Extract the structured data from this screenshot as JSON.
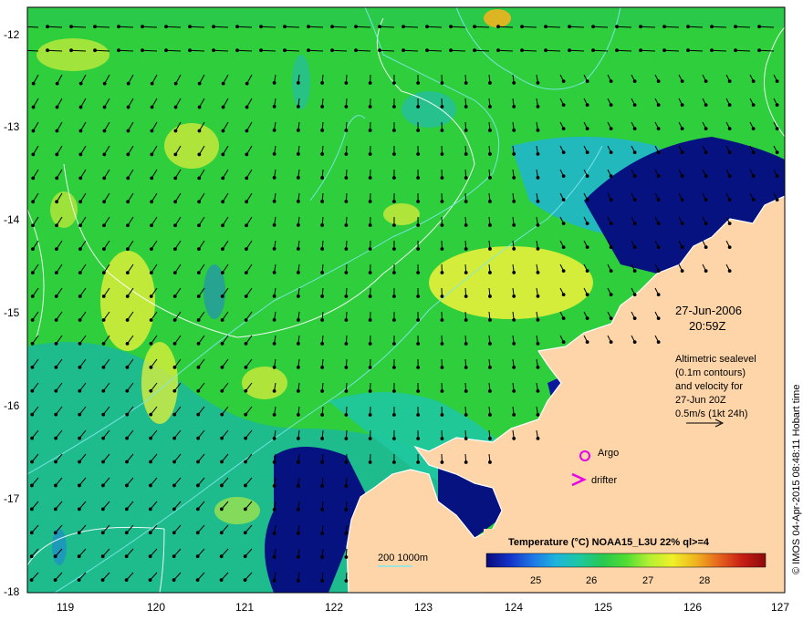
{
  "map": {
    "lat_ticks": [
      "-12",
      "-13",
      "-14",
      "-15",
      "-16",
      "-17",
      "-18"
    ],
    "lon_ticks": [
      "119",
      "120",
      "121",
      "122",
      "123",
      "124",
      "125",
      "126",
      "127"
    ],
    "date_line1": "27-Jun-2006",
    "date_line2": "20:59Z",
    "info_lines": [
      "Altimetric sealevel",
      "(0.1m contours)",
      "and velocity for",
      "27-Jun 20Z",
      "0.5m/s (1kt 24h)"
    ],
    "argo_label": "Argo",
    "drifter_label": "drifter",
    "depth_label": "200  1000m",
    "credit": "© IMOS 04-Apr-2015 08:48:11 Hobart time",
    "colors": {
      "land": "#fdd5a8",
      "deep_blue": "#06127f",
      "green": "#2fce3c",
      "yellow": "#f0f23a",
      "teal": "#1bb89a",
      "marker": "#e800e8",
      "contour": "#7ee8ee"
    }
  },
  "legend": {
    "title": "Temperature (°C) NOAA15_L3U 22% ql>=4",
    "ticks": [
      "25",
      "26",
      "27",
      "28"
    ],
    "colormap": [
      "#0a0a7a",
      "#1432c8",
      "#1e78e6",
      "#1eb4dc",
      "#1ec8a0",
      "#28c850",
      "#50dc32",
      "#b4f032",
      "#f0f028",
      "#f0b41e",
      "#e6641e",
      "#c81e14",
      "#8c0a0a"
    ]
  }
}
